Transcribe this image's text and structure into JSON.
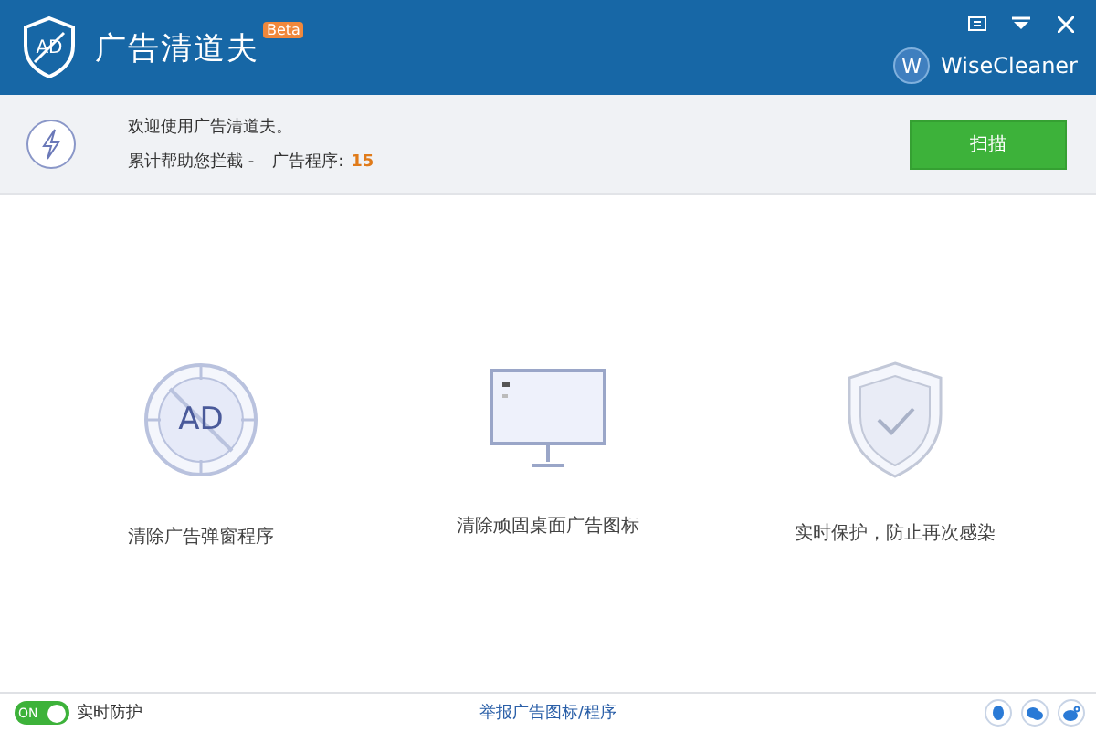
{
  "header": {
    "logo_text": "AD",
    "title": "广告清道夫",
    "badge": "Beta",
    "brand": "WiseCleaner",
    "brand_initial": "W"
  },
  "info": {
    "welcome": "欢迎使用广告清道夫。",
    "blocked_label": "累计帮助您拦截 -",
    "programs_label": "广告程序:",
    "programs_count": "15",
    "scan_button": "扫描"
  },
  "features": [
    {
      "kind": "ad",
      "icon_text": "AD",
      "label": "清除广告弹窗程序"
    },
    {
      "kind": "desktop",
      "label": "清除顽固桌面广告图标"
    },
    {
      "kind": "shield",
      "label": "实时保护，防止再次感染"
    }
  ],
  "footer": {
    "toggle": {
      "label": "ON",
      "on": true
    },
    "toggle_caption": "实时防护",
    "report_link": "举报广告图标/程序"
  }
}
